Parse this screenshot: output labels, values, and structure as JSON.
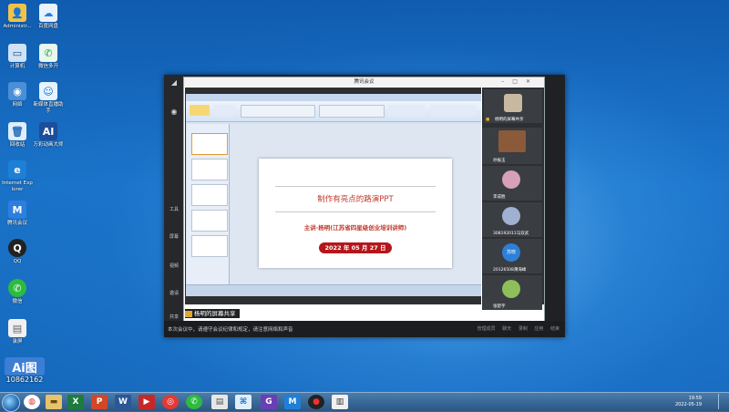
{
  "desktop": {
    "icons": [
      {
        "label": "Administr...",
        "icon": "user-folder-icon"
      },
      {
        "label": "百度网盘",
        "icon": "cloud-disk-icon"
      },
      {
        "label": "计算机",
        "icon": "computer-icon"
      },
      {
        "label": "微信多开",
        "icon": "wechat-multi-icon"
      },
      {
        "label": "网络",
        "icon": "network-icon"
      },
      {
        "label": "新媒体直播助手",
        "icon": "live-assistant-icon"
      },
      {
        "label": "回收站",
        "icon": "recycle-bin-icon"
      },
      {
        "label": "万彩动画大师",
        "icon": "animation-icon"
      },
      {
        "label": "Internet Explorer",
        "icon": "ie-icon"
      },
      {
        "label": "腾讯会议",
        "icon": "tencent-meeting-icon"
      },
      {
        "label": "QQ",
        "icon": "qq-icon"
      },
      {
        "label": "微信",
        "icon": "wechat-icon"
      },
      {
        "label": "录屏",
        "icon": "file-icon"
      },
      {
        "label": "Ai图",
        "icon": "ai-tool-icon"
      }
    ],
    "overlay_text": "10862162"
  },
  "meeting": {
    "window_title": "腾讯会议",
    "rail": [
      "工具",
      "屏幕",
      "视频",
      "邀请",
      "共享"
    ],
    "share_label": "杨明的屏幕共享",
    "bottom_text": "本次会议中，请遵守会议纪律和规定，请注意网络和声音",
    "bottom_right": "管理成员 聊天 录制 应用 结束",
    "participants": [
      {
        "name": "杨明的屏幕共享",
        "color": "#c9b8a0"
      },
      {
        "name": "孙振玉",
        "color": "#8a5a3a"
      },
      {
        "name": "李成胜",
        "color": "#d6a0b8"
      },
      {
        "name": "308192011马双武",
        "color": "#9fb0d0"
      },
      {
        "name": "20126508薄海峰",
        "color": "#2e7fd8",
        "initials": "苏晓"
      },
      {
        "name": "张楚宇",
        "color": "#8fbf5a"
      }
    ]
  },
  "slide": {
    "title": "制作有亮点的路演PPT",
    "author": "主讲·杨明(江苏省四星级创业培训讲师)",
    "date": "2022 年 05 月 27 日"
  },
  "taskbar": {
    "clock_time": "19:59",
    "clock_date": "2022-05-19",
    "apps": [
      "chrome-icon",
      "folder-icon",
      "excel-icon",
      "powerpoint-icon",
      "word-icon",
      "app-red-icon",
      "weibo-icon",
      "wechat-icon",
      "file-icon",
      "network-icon",
      "g-app-icon",
      "meeting-icon",
      "screen-record-icon",
      "document-icon"
    ]
  }
}
